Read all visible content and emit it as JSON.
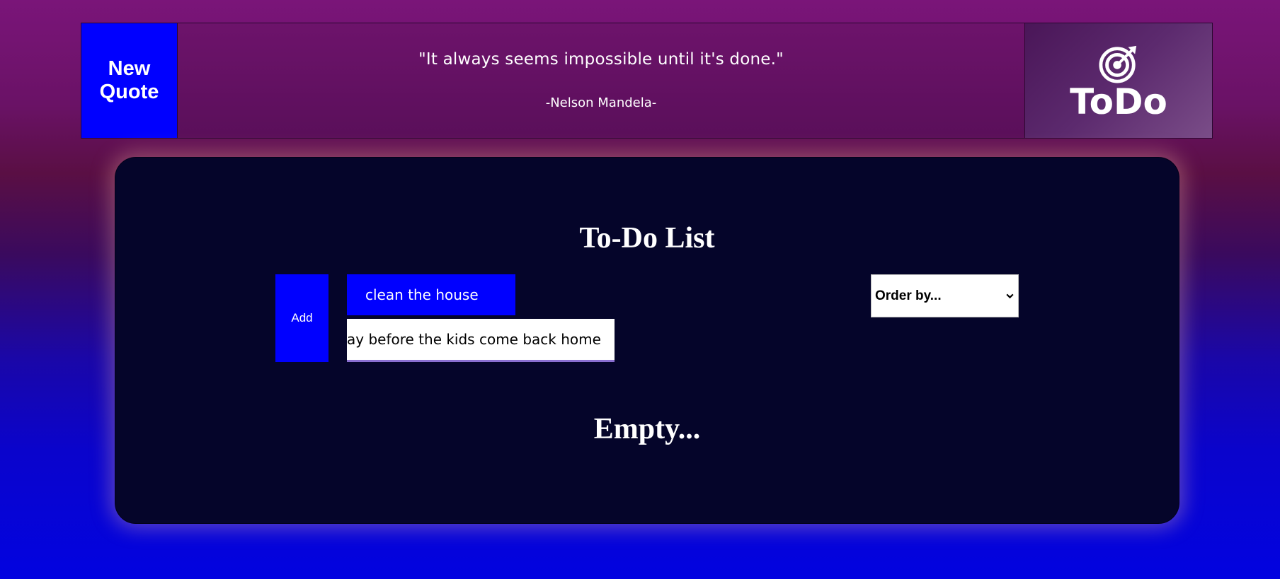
{
  "header": {
    "new_quote_label": "New Quote",
    "quote": "\"It always seems impossible until it's done.\"",
    "author": "-Nelson Mandela-",
    "brand_name": "ToDo",
    "brand_icon": "target-arrow-icon"
  },
  "todo": {
    "title": "To-Do List",
    "add_label": "Add",
    "title_input_value": "clean the house",
    "description_input_value": "ay before the kids come back home",
    "order_select": {
      "selected": "Order by...",
      "icon": "chevron-down-icon"
    },
    "empty_message": "Empty..."
  },
  "colors": {
    "accent_blue": "#0000ff",
    "card_bg": "#05052a",
    "input_underline": "#8a6fd0"
  }
}
